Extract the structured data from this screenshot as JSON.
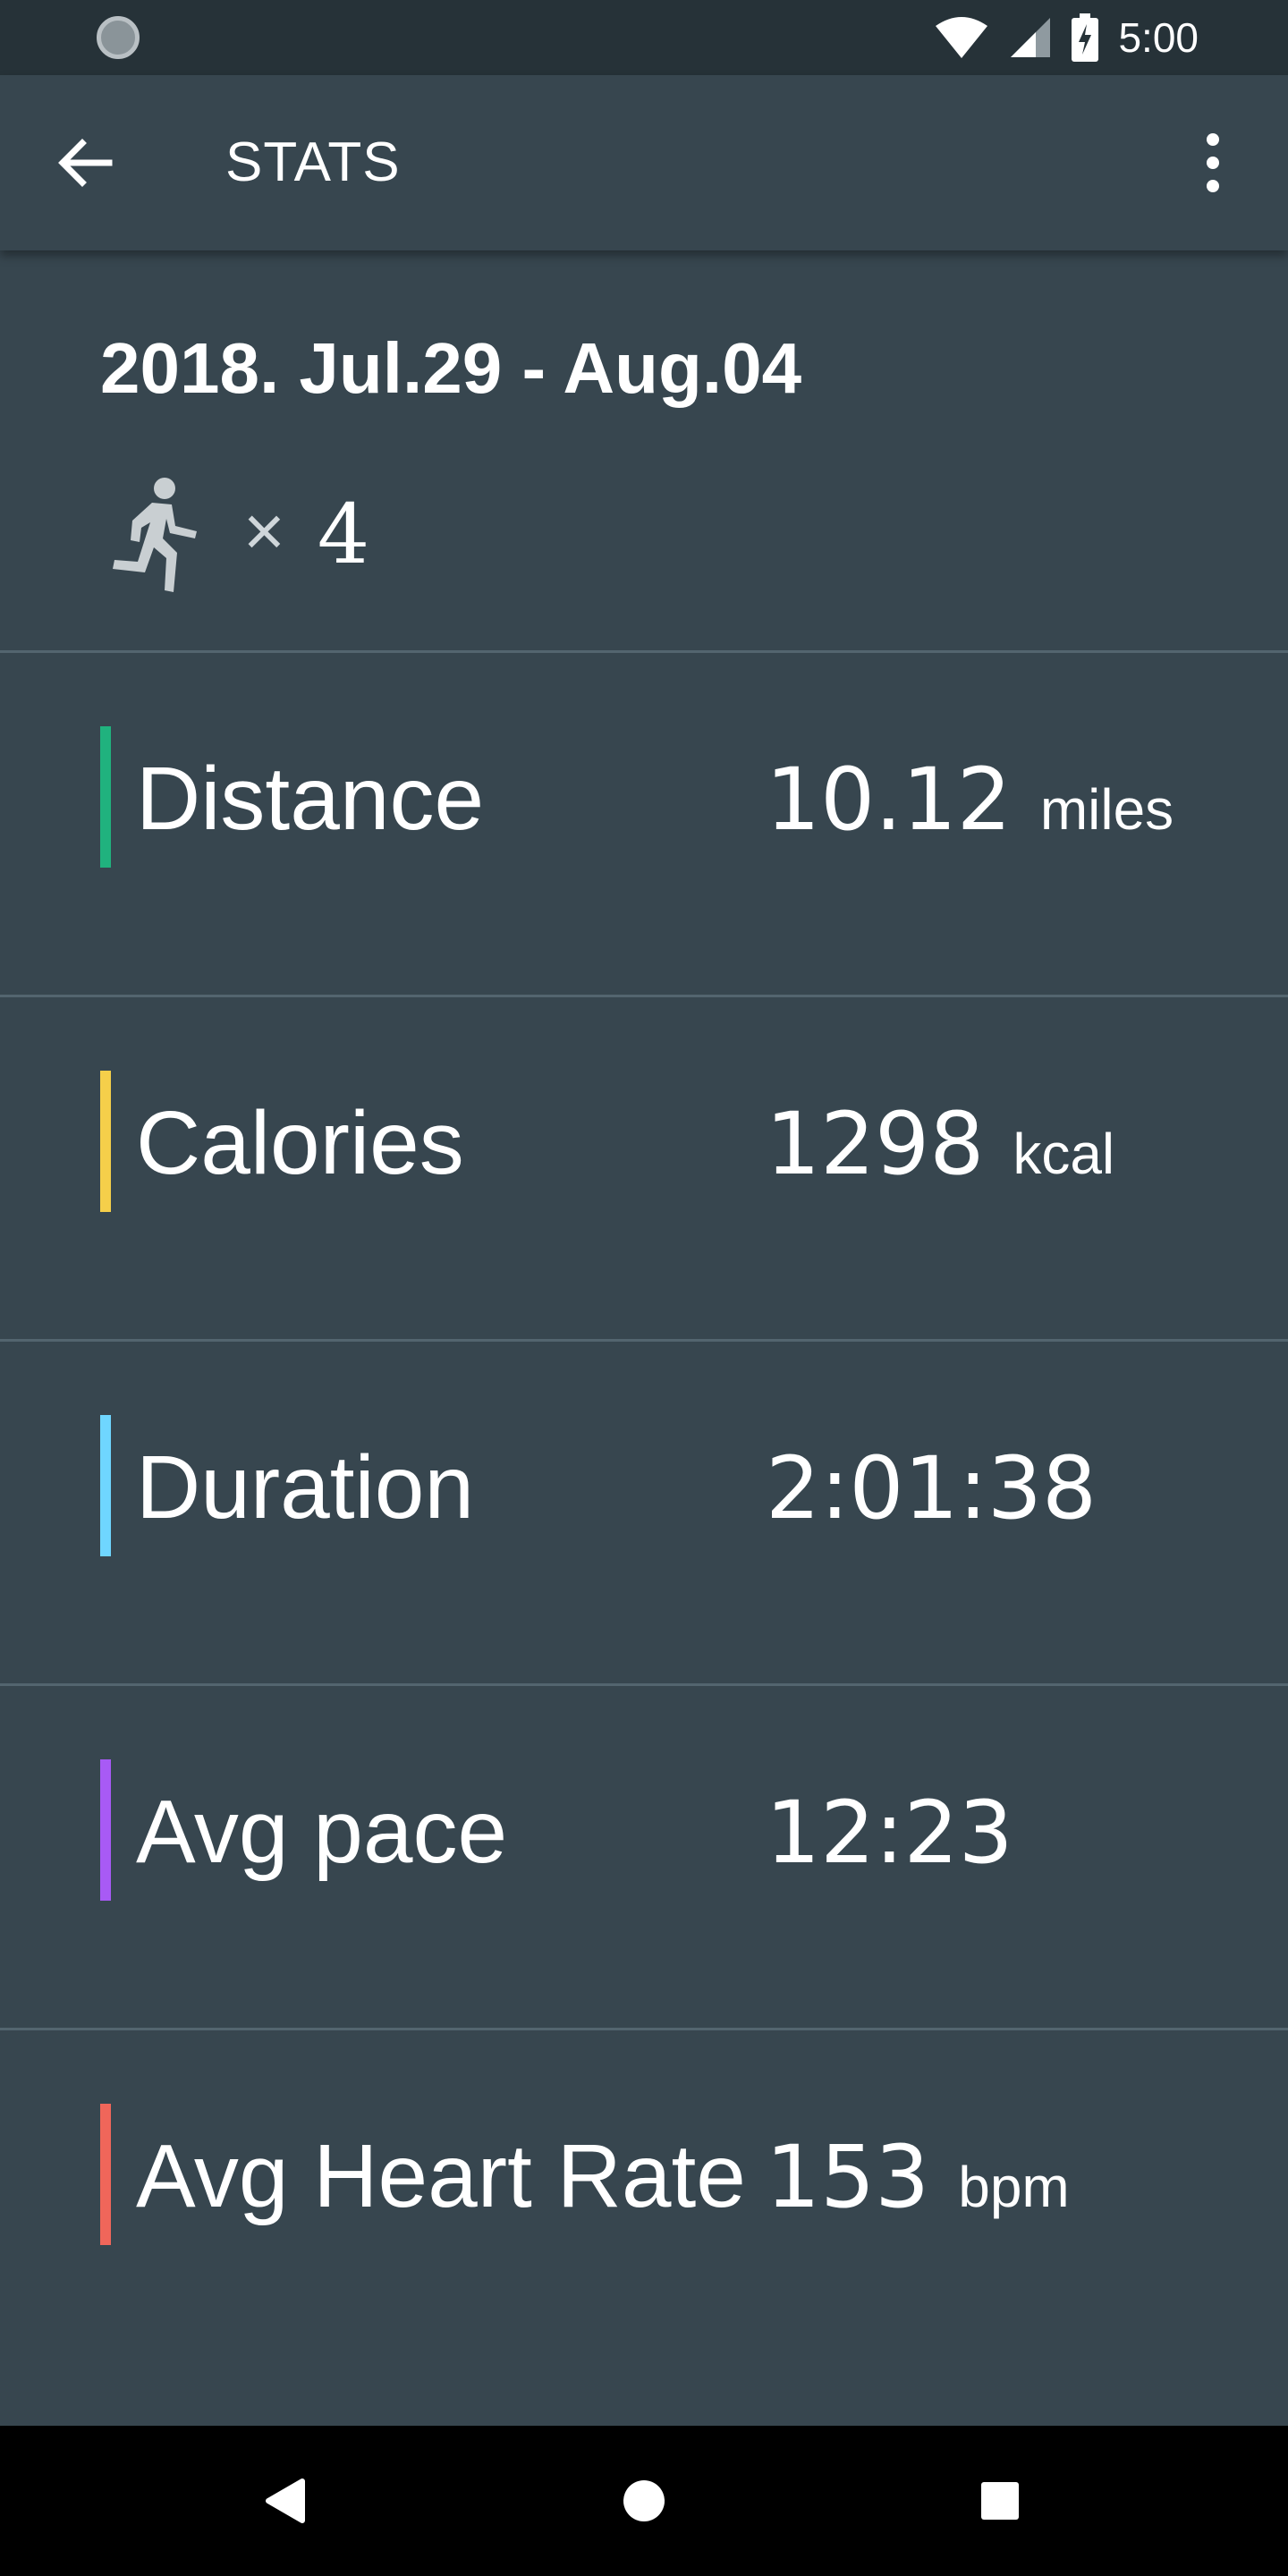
{
  "status_bar": {
    "time": "5:00",
    "icons": [
      "sync-icon",
      "wifi-icon",
      "signal-icon",
      "battery-charging-icon"
    ]
  },
  "app_bar": {
    "title": "STATS",
    "back_icon": "arrow-left-icon",
    "menu_icon": "more-vertical-icon"
  },
  "header": {
    "date_range": "2018. Jul.29 - Aug.04",
    "activity_icon": "running-icon",
    "multiplier": "×",
    "count": "4"
  },
  "stats": [
    {
      "label": "Distance",
      "value": "10.12",
      "unit": "miles",
      "color": "#20b27e"
    },
    {
      "label": "Calories",
      "value": "1298",
      "unit": "kcal",
      "color": "#f5cf4a"
    },
    {
      "label": "Duration",
      "value": "2:01:38",
      "unit": "",
      "color": "#6fd6ff"
    },
    {
      "label": "Avg pace",
      "value": "12:23",
      "unit": "",
      "color": "#a85af5"
    },
    {
      "label": "Avg Heart Rate",
      "value": "153",
      "unit": "bpm",
      "color": "#f0665a"
    }
  ],
  "nav_bar": {
    "icons": [
      "back-triangle-icon",
      "home-circle-icon",
      "recents-square-icon"
    ]
  }
}
